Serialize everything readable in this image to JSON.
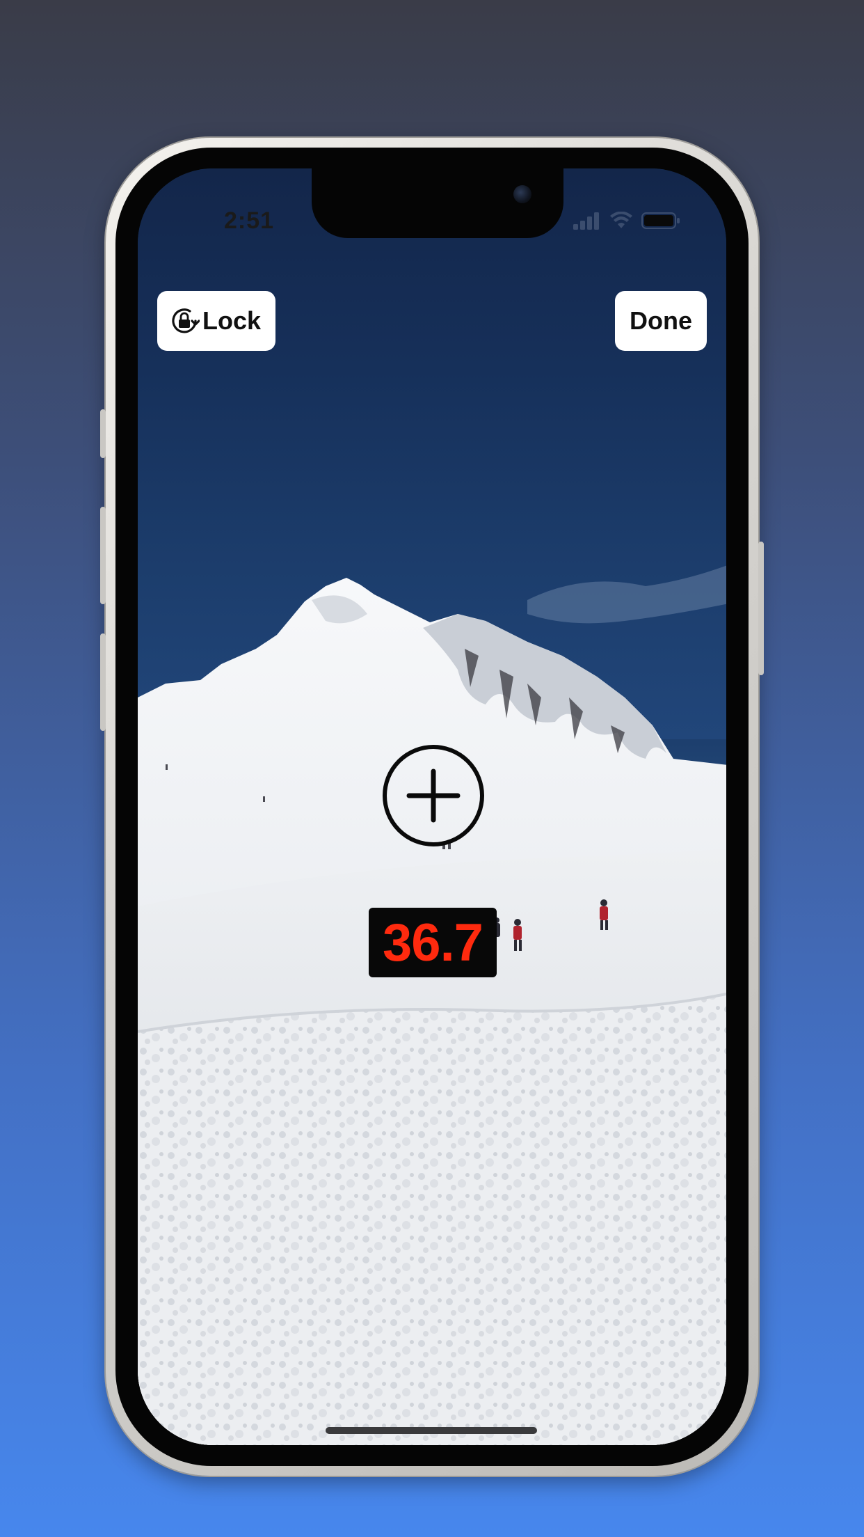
{
  "status_bar": {
    "time": "2:51",
    "signal_icon": "cellular-signal-icon",
    "wifi_icon": "wifi-icon",
    "battery_icon": "battery-icon"
  },
  "toolbar": {
    "lock_label": "Lock",
    "lock_icon": "lock-rotation-icon",
    "done_label": "Done"
  },
  "viewfinder": {
    "crosshair_icon": "crosshair-plus-icon",
    "measurement_value": "36.7",
    "measurement_color": "#ff2a0e"
  },
  "colors": {
    "background_top": "#3a3c48",
    "background_bottom": "#4787ed",
    "button_bg": "#ffffff"
  }
}
